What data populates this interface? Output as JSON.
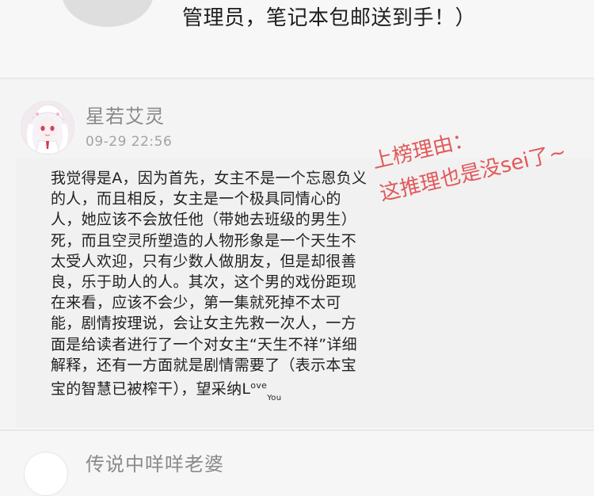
{
  "previous_post": {
    "text": "管理员，笔记本包邮送到手！）"
  },
  "comment": {
    "username": "星若艾灵",
    "timestamp": "09-29 22:56",
    "lines": [
      "我觉得是A，因为首先，女主不是一个忘恩负义",
      "的人，而且相反，女主是一个极具同情心的",
      "人，她应该不会放任他（带她去班级的男生）",
      "死，而且空灵所塑造的人物形象是一个天生不",
      "太受人欢迎，只有少数人做朋友，但是却很善",
      "良，乐于助人的人。其次，这个男的戏份距现",
      "在来看，应该不会少，第一集就死掉不太可",
      "能，剧情按理说，会让女主先救一次人，一方",
      "面是给读者进行了一个对女主“天生不祥”详细",
      "解释，还有一方面就是剧情需要了（表示本宝"
    ],
    "last_line_prefix": "宝的智慧已被榨干），望采纳L",
    "last_line_sup": "ove",
    "last_line_sub": "You"
  },
  "overlay_note": {
    "line1": "上榜理由：",
    "line2": "这推理也是没sei了~",
    "color": "#e2585a"
  },
  "next_comment": {
    "username": "传说中咩咩老婆"
  }
}
